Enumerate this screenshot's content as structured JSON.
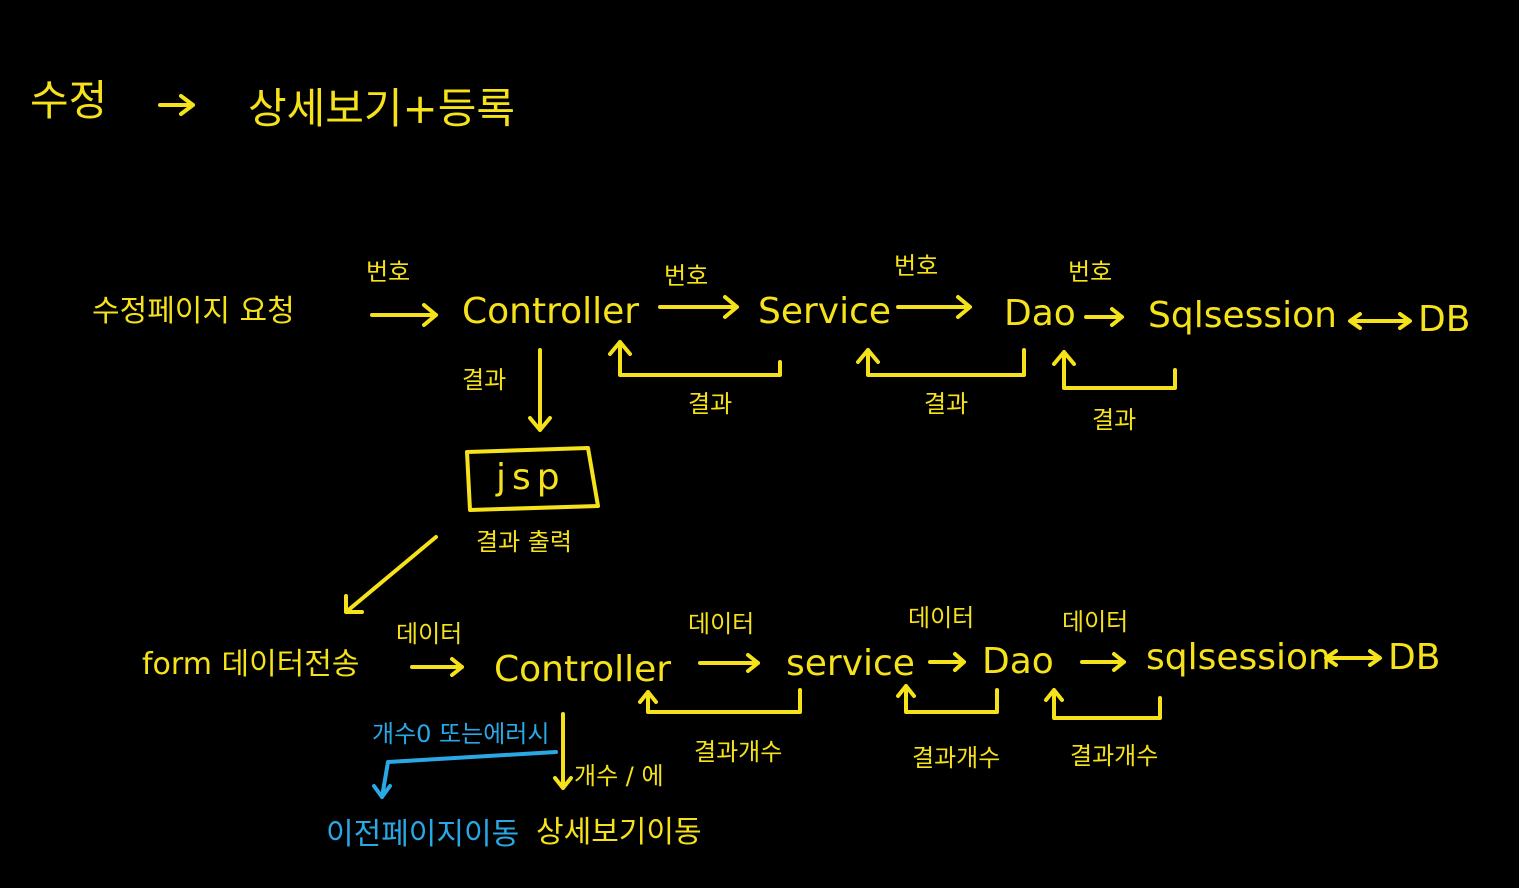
{
  "colors": {
    "background": "#000000",
    "ink": "#f5e21a",
    "error_ink": "#2aa8e6"
  },
  "title": {
    "left": "수정",
    "arrow": "→",
    "right": "상세보기+등록"
  },
  "row1": {
    "request": "수정페이지 요청",
    "controller": "Controller",
    "service": "Service",
    "dao": "Dao",
    "sqlsession": "Sqlsession",
    "db": "DB",
    "call_labels": [
      "번호",
      "번호",
      "번호",
      "번호"
    ],
    "result_labels": [
      "결과",
      "결과",
      "결과"
    ],
    "down_label": "결과",
    "jsp": "jsp",
    "jsp_caption": "결과 출력"
  },
  "row2": {
    "form": "form 데이터전송",
    "controller": "Controller",
    "service": "service",
    "dao": "Dao",
    "sqlsession": "sqlsession",
    "db": "DB",
    "call_labels": [
      "데이터",
      "데이터",
      "데이터",
      "데이터"
    ],
    "result_labels": [
      "결과개수",
      "결과개수",
      "결과개수"
    ],
    "success_label": "개수 / 에",
    "success_target": "상세보기이동",
    "error_label": "개수0 또는에러시",
    "error_target": "이전페이지이동"
  }
}
